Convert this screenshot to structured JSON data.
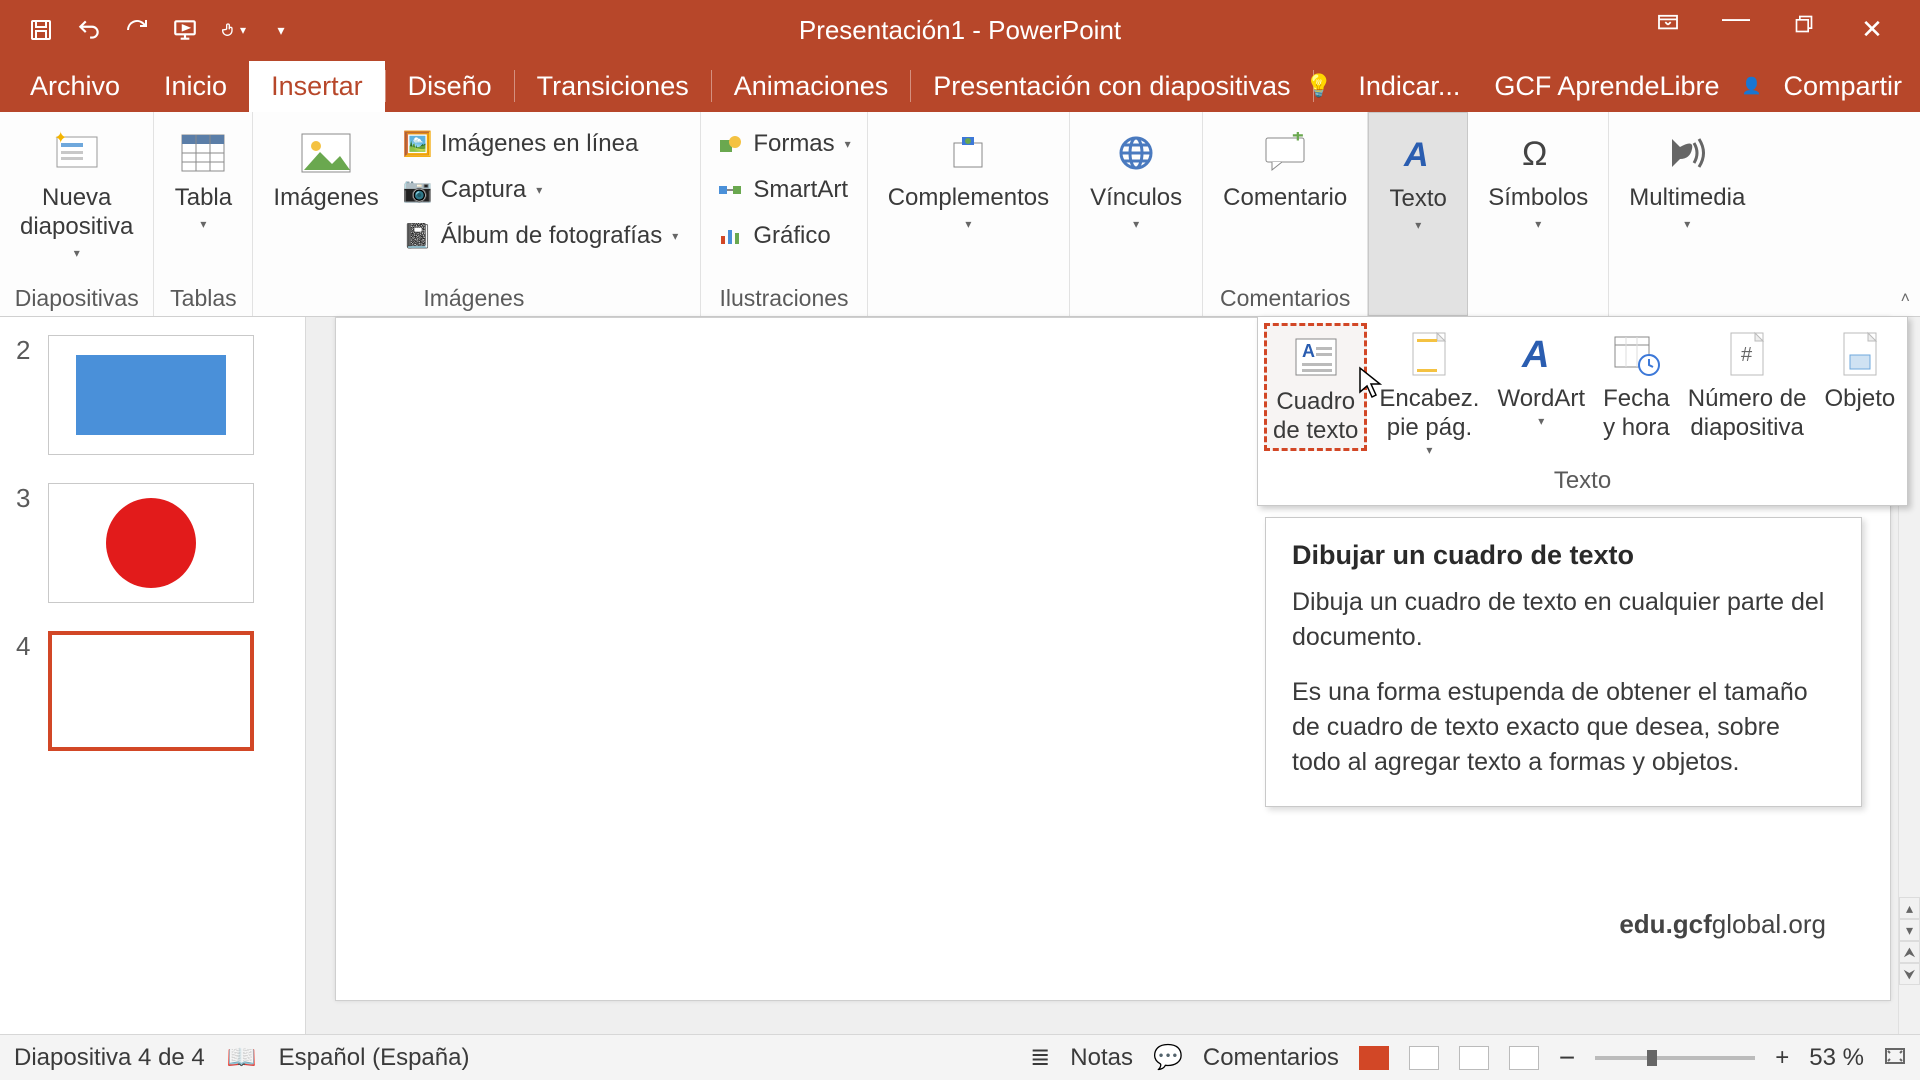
{
  "window": {
    "title": "Presentación1 - PowerPoint"
  },
  "tabs": {
    "archivo": "Archivo",
    "inicio": "Inicio",
    "insertar": "Insertar",
    "diseno": "Diseño",
    "transiciones": "Transiciones",
    "animaciones": "Animaciones",
    "presentacion": "Presentación con diapositivas",
    "indicar": "Indicar...",
    "gcf": "GCF AprendeLibre",
    "compartir": "Compartir"
  },
  "ribbon": {
    "diapositivas": {
      "nueva": "Nueva\ndiapositiva",
      "group": "Diapositivas"
    },
    "tablas": {
      "tabla": "Tabla",
      "group": "Tablas"
    },
    "imagenes": {
      "imagenes": "Imágenes",
      "imagenes_en_linea": "Imágenes en línea",
      "captura": "Captura",
      "album": "Álbum de fotografías",
      "group": "Imágenes"
    },
    "ilustraciones": {
      "formas": "Formas",
      "smartart": "SmartArt",
      "grafico": "Gráfico",
      "group": "Ilustraciones"
    },
    "complementos": "Complementos",
    "vinculos": "Vínculos",
    "comentarios": {
      "comentario": "Comentario",
      "group": "Comentarios"
    },
    "texto": "Texto",
    "simbolos": "Símbolos",
    "multimedia": "Multimedia"
  },
  "gallery": {
    "cuadro": "Cuadro\nde texto",
    "encabez": "Encabez.\npie pág.",
    "wordart": "WordArt",
    "fecha": "Fecha\ny hora",
    "numero": "Número de\ndiapositiva",
    "objeto": "Objeto",
    "group": "Texto"
  },
  "tooltip": {
    "title": "Dibujar un cuadro de texto",
    "p1": "Dibuja un cuadro de texto en cualquier parte del documento.",
    "p2": "Es una forma estupenda de obtener el tamaño de cuadro de texto exacto que desea, sobre todo al agregar texto a formas y objetos."
  },
  "thumbs": {
    "n2": "2",
    "n3": "3",
    "n4": "4"
  },
  "watermark": {
    "a": "edu.gcf",
    "b": "global.org"
  },
  "status": {
    "slide": "Diapositiva 4 de 4",
    "lang": "Español (España)",
    "notas": "Notas",
    "comentarios": "Comentarios",
    "zoom": "53 %"
  }
}
